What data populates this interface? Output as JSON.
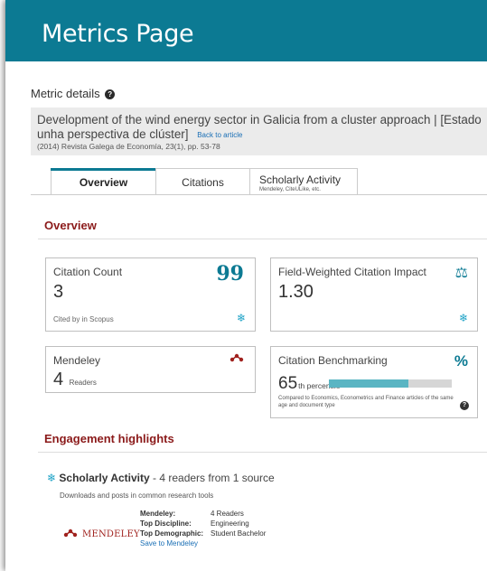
{
  "header": {
    "title": "Metrics Page"
  },
  "metric_details": {
    "label": "Metric details"
  },
  "article": {
    "title_line1": "Development of the wind energy sector in Galicia from a cluster approach | [Estado",
    "title_line2": "unha perspectiva de clúster]",
    "back_link": "Back to article",
    "source": "(2014) Revista Galega de Economía, 23(1), pp. 53-78"
  },
  "tabs": [
    {
      "label": "Overview",
      "sub": ""
    },
    {
      "label": "Citations",
      "sub": ""
    },
    {
      "label": "Scholarly Activity",
      "sub": "Mendeley, CiteULike, etc."
    }
  ],
  "overview": {
    "heading": "Overview",
    "citation_count": {
      "label": "Citation Count",
      "value": "3",
      "note": "Cited by in Scopus"
    },
    "fwci": {
      "label": "Field-Weighted Citation Impact",
      "value": "1.30"
    },
    "mendeley": {
      "label": "Mendeley",
      "value": "4",
      "unit": "Readers"
    },
    "benchmarking": {
      "label": "Citation Benchmarking",
      "value": "65",
      "suffix": "th percentile",
      "percentile": 65,
      "note": "Compared to Economics, Econometrics and Finance articles of the same age and document type"
    }
  },
  "engagement": {
    "heading": "Engagement highlights",
    "scholarly_activity": {
      "label": "Scholarly Activity",
      "summary": " - 4 readers from 1 source",
      "sub": "Downloads and posts in common research tools"
    },
    "mendeley_logo": "MENDELEY",
    "details": [
      {
        "key": "Mendeley:",
        "value": "4 Readers"
      },
      {
        "key": "Top Discipline:",
        "value": "Engineering"
      },
      {
        "key": "Top Demographic:",
        "value": "Student Bachelor"
      }
    ],
    "save_link": "Save to Mendeley"
  },
  "colors": {
    "accent": "#0c7a93",
    "section": "#8b1a1a",
    "mendeley": "#a0221e",
    "bar_fill": "#5ab5c3"
  }
}
